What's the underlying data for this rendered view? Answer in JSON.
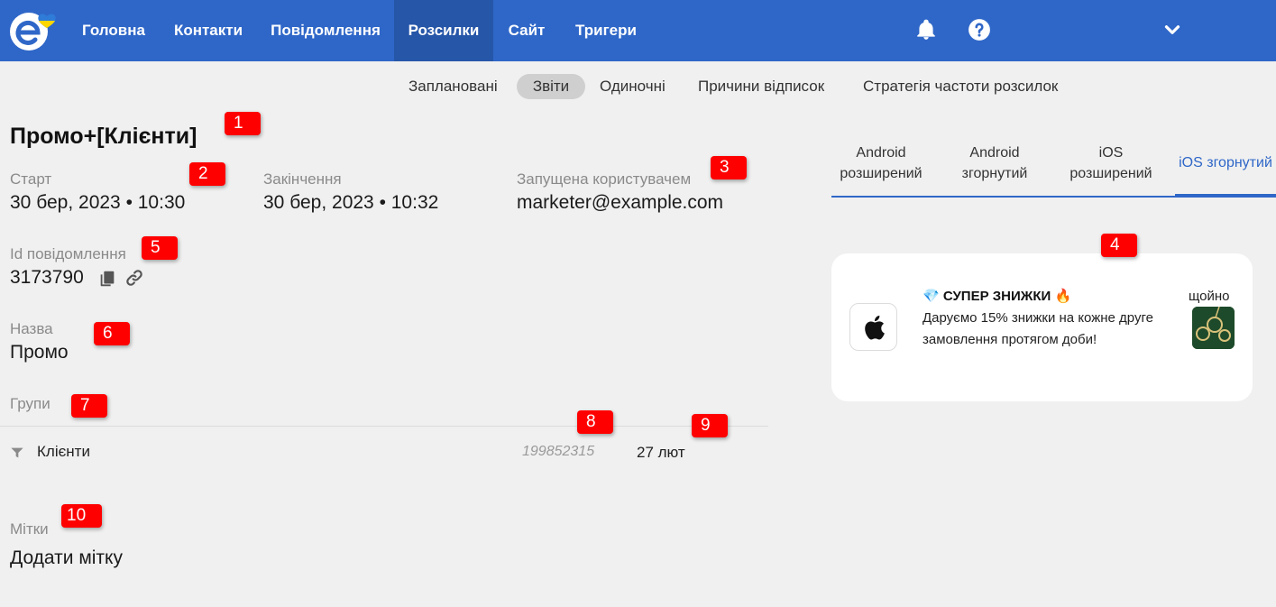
{
  "nav": {
    "items": [
      "Головна",
      "Контакти",
      "Повідомлення",
      "Розсилки",
      "Сайт",
      "Тригери"
    ],
    "active": "Розсилки"
  },
  "subnav": {
    "items": [
      "Заплановані",
      "Звіти",
      "Одиночні",
      "Причини відписок",
      "Стратегія частоти розсилок"
    ],
    "active": "Звіти"
  },
  "title": "Промо+[Клієнти]",
  "start": {
    "label": "Старт",
    "value": "30 бер, 2023 • 10:30"
  },
  "end": {
    "label": "Закінчення",
    "value": "30 бер, 2023 • 10:32"
  },
  "launched": {
    "label": "Запущена користувачем",
    "value": "marketer@example.com"
  },
  "message_id": {
    "label": "Id повідомлення",
    "value": "3173790"
  },
  "name": {
    "label": "Назва",
    "value": "Промо"
  },
  "groups": {
    "label": "Групи",
    "rows": [
      {
        "name": "Клієнти",
        "id": "199852315",
        "date": "27 лют"
      }
    ]
  },
  "tags": {
    "label": "Мітки",
    "value": "Додати мітку"
  },
  "preview": {
    "tabs": [
      {
        "label": "Android розширений"
      },
      {
        "label": "Android згорнутий"
      },
      {
        "label": "iOS розширений"
      },
      {
        "label": "iOS згорнутий"
      }
    ],
    "active": "iOS згорнутий",
    "notification": {
      "title": "💎 СУПЕР ЗНИЖКИ 🔥",
      "body": "Даруємо 15% знижки на кожне друге замовлення протягом доби!",
      "time": "щойно"
    }
  },
  "badges": [
    "1",
    "2",
    "3",
    "4",
    "5",
    "6",
    "7",
    "8",
    "9",
    "10"
  ],
  "colors": {
    "primary": "#2f67c8",
    "badge": "#ff0000",
    "background": "#f0f0f0"
  }
}
